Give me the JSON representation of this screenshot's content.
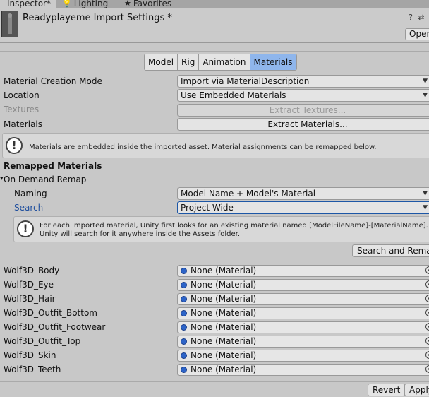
{
  "tabs": [
    {
      "label": "Inspector*",
      "icon": "inspector-icon"
    },
    {
      "label": "Lighting",
      "icon": "lightbulb-icon"
    },
    {
      "label": "Favorites",
      "icon": "star-icon"
    }
  ],
  "header": {
    "title": "Readyplayeme Import Settings *",
    "open_label": "Open",
    "help_icon": "help-icon",
    "settings_icon": "preset-icon"
  },
  "segments": [
    "Model",
    "Rig",
    "Animation",
    "Materials"
  ],
  "active_segment": "Materials",
  "settings": {
    "material_creation_mode": {
      "label": "Material Creation Mode",
      "value": "Import via MaterialDescription"
    },
    "location": {
      "label": "Location",
      "value": "Use Embedded Materials"
    },
    "textures": {
      "label": "Textures",
      "button": "Extract Textures..."
    },
    "materials": {
      "label": "Materials",
      "button": "Extract Materials..."
    }
  },
  "help1": "Materials are embedded inside the imported asset. Material assignments can be remapped below.",
  "remapped": {
    "heading": "Remapped Materials",
    "on_demand": "On Demand Remap",
    "naming_label": "Naming",
    "naming_value": "Model Name + Model's Material",
    "search_label": "Search",
    "search_value": "Project-Wide",
    "help2_line1": "For each imported material, Unity first looks for an existing material named [ModelFileName]-[MaterialName].",
    "help2_line2": "Unity will search for it anywhere inside the Assets folder.",
    "search_button": "Search and Remap"
  },
  "material_slots": [
    {
      "name": "Wolf3D_Body",
      "value": "None (Material)"
    },
    {
      "name": "Wolf3D_Eye",
      "value": "None (Material)"
    },
    {
      "name": "Wolf3D_Hair",
      "value": "None (Material)"
    },
    {
      "name": "Wolf3D_Outfit_Bottom",
      "value": "None (Material)"
    },
    {
      "name": "Wolf3D_Outfit_Footwear",
      "value": "None (Material)"
    },
    {
      "name": "Wolf3D_Outfit_Top",
      "value": "None (Material)"
    },
    {
      "name": "Wolf3D_Skin",
      "value": "None (Material)"
    },
    {
      "name": "Wolf3D_Teeth",
      "value": "None (Material)"
    }
  ],
  "footer": {
    "revert": "Revert",
    "apply": "Apply"
  },
  "colors": {
    "active_segment": "#8fb6ec",
    "link_blue": "#1f4f9e",
    "object_dot": "#2d64c8"
  }
}
